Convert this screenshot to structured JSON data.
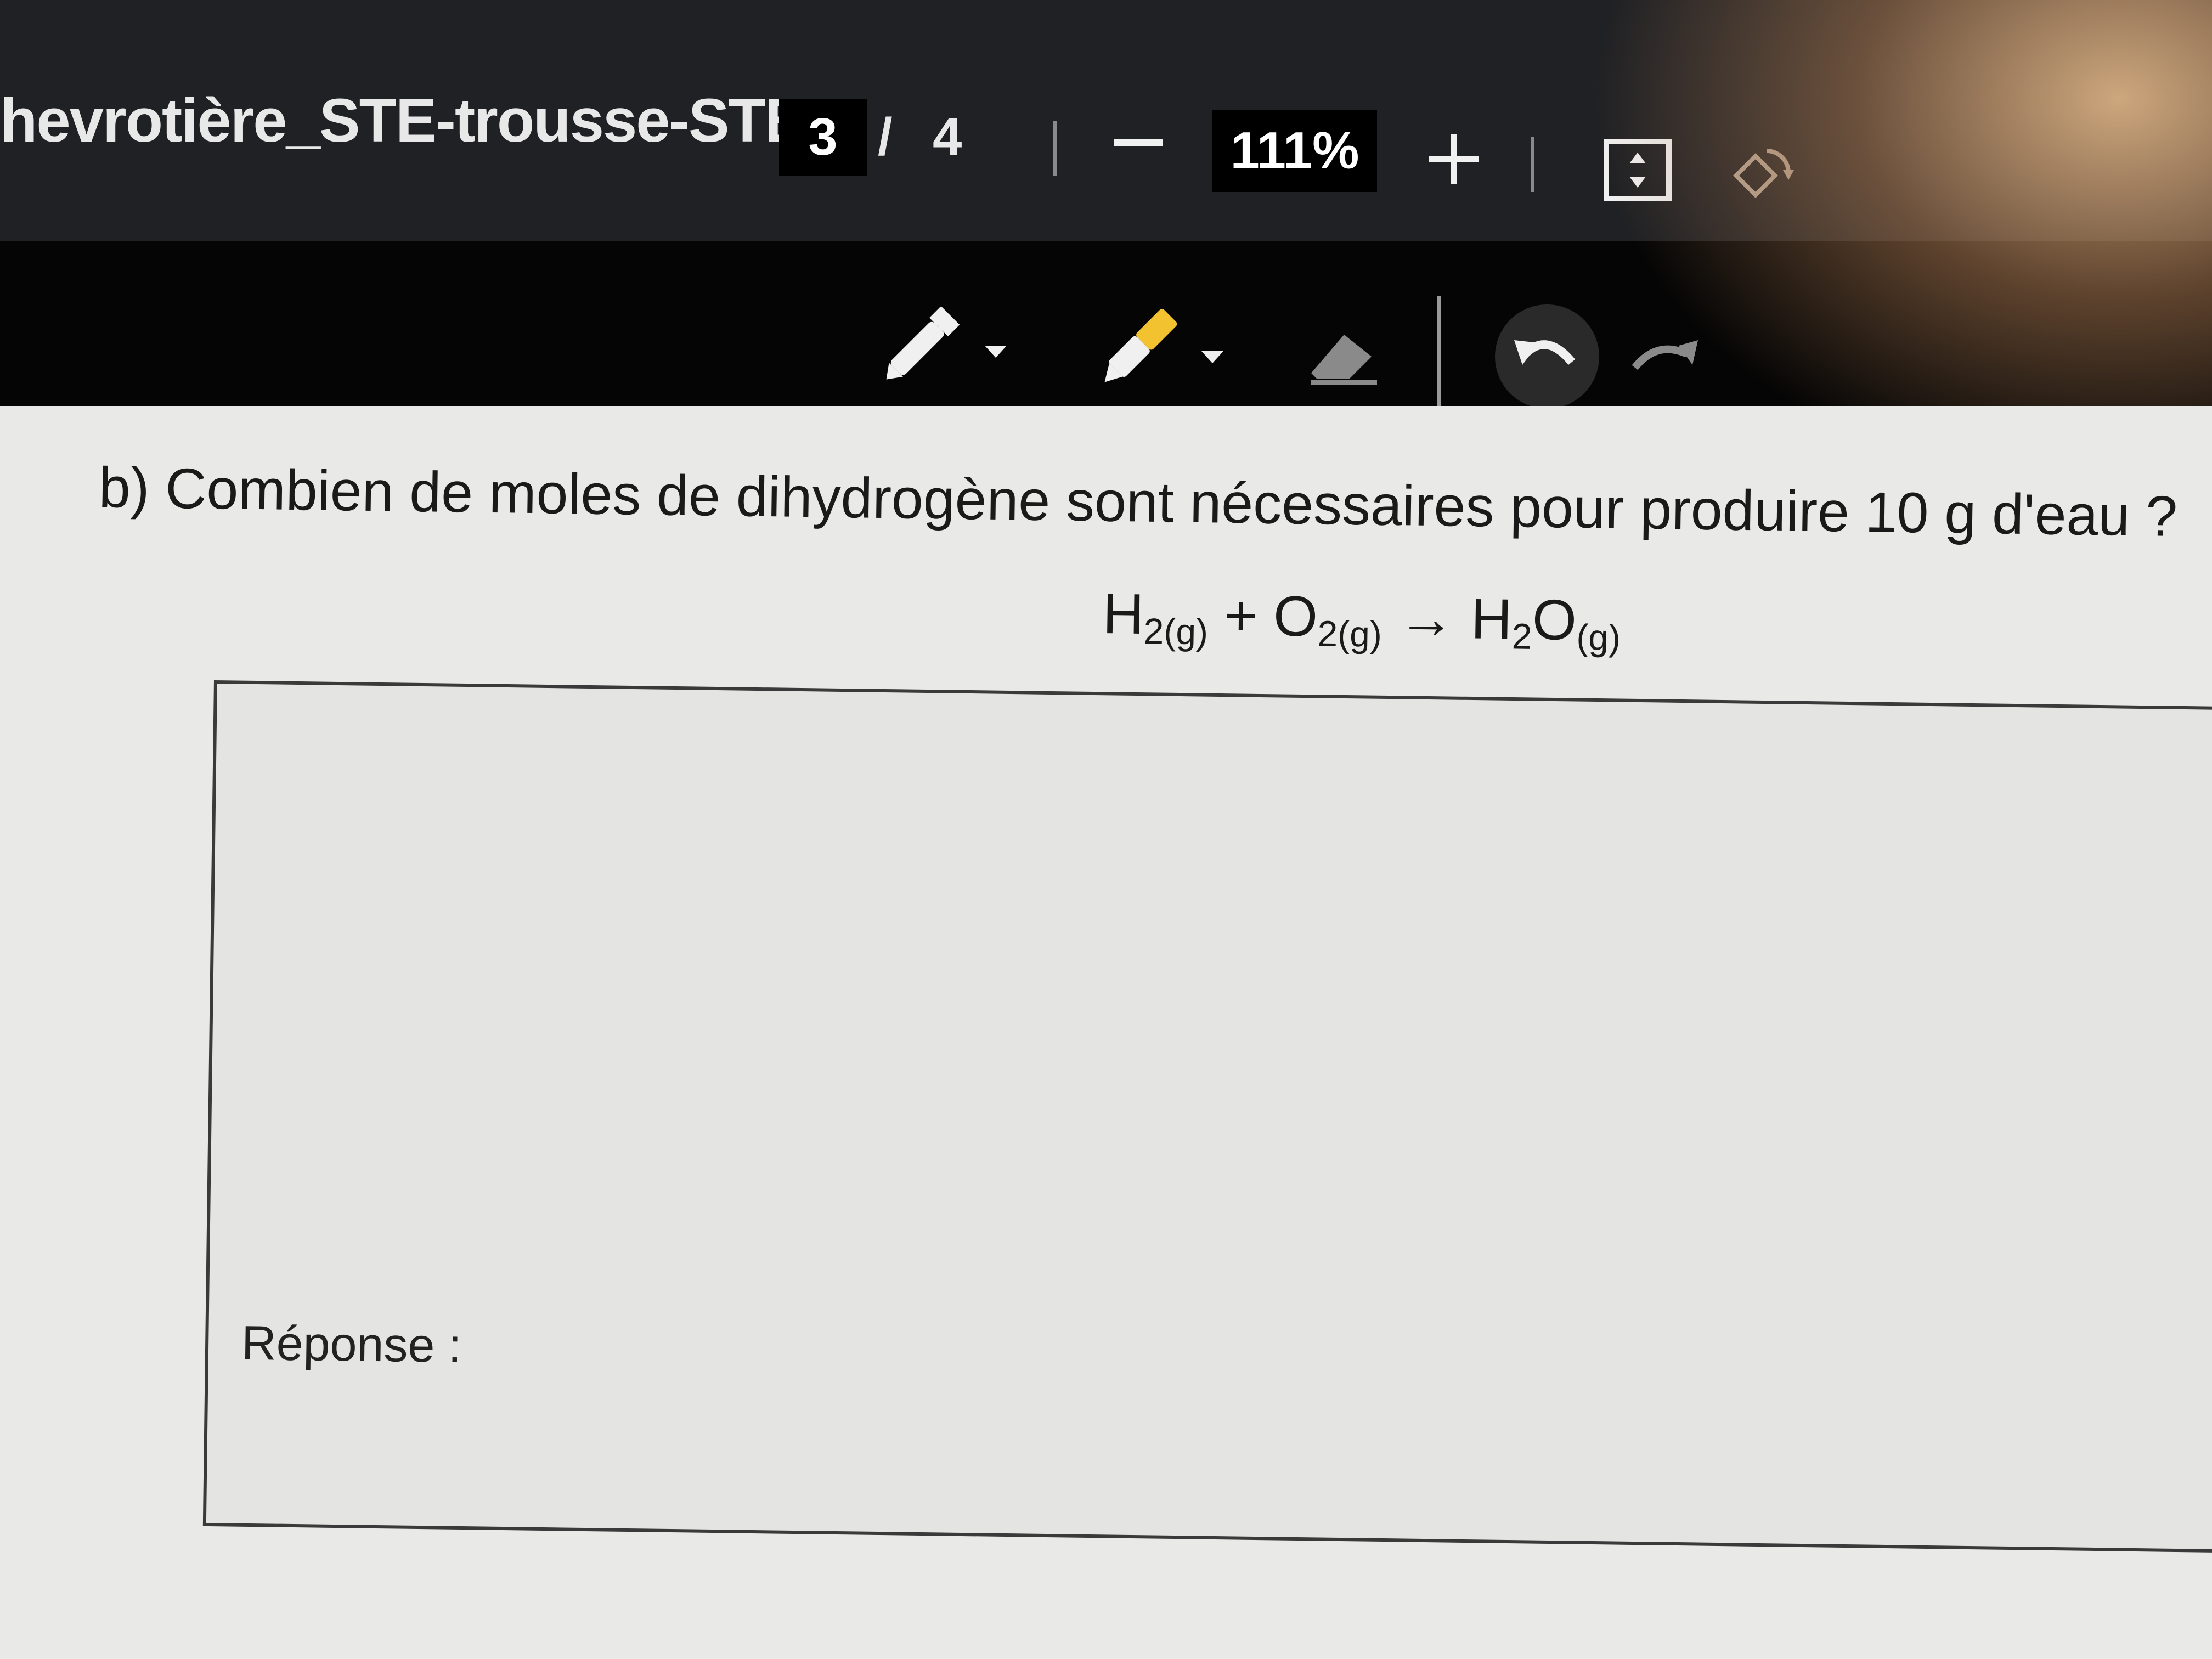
{
  "toolbar": {
    "file_title": "hevrotière_STE-trousse-STE...",
    "current_page": "3",
    "page_separator": "/",
    "total_pages": "4",
    "zoom_level": "111%"
  },
  "icons": {
    "zoom_out": "minus-icon",
    "zoom_in": "plus-icon",
    "fit_page": "fit-page-icon",
    "rotate": "rotate-icon",
    "pen": "pen-icon",
    "highlighter": "highlighter-icon",
    "eraser": "eraser-icon",
    "undo": "undo-icon",
    "redo": "redo-icon"
  },
  "colors": {
    "toolbar_bg": "#202124",
    "highlighter_yellow": "#f2c230",
    "document_bg": "#e9e9e7"
  },
  "document": {
    "question_text": "b)  Combien de moles de dihydrogène sont nécessaires pour produire 10 g d'eau ?",
    "equation": {
      "reactant1": "H",
      "reactant1_sub": "2(g)",
      "plus": "+",
      "reactant2": "O",
      "reactant2_sub": "2(g)",
      "arrow": "→",
      "product": "H",
      "product_mid_sub": "2",
      "product_end": "O",
      "product_sub": "(g)"
    },
    "answer_label": "Réponse :"
  }
}
